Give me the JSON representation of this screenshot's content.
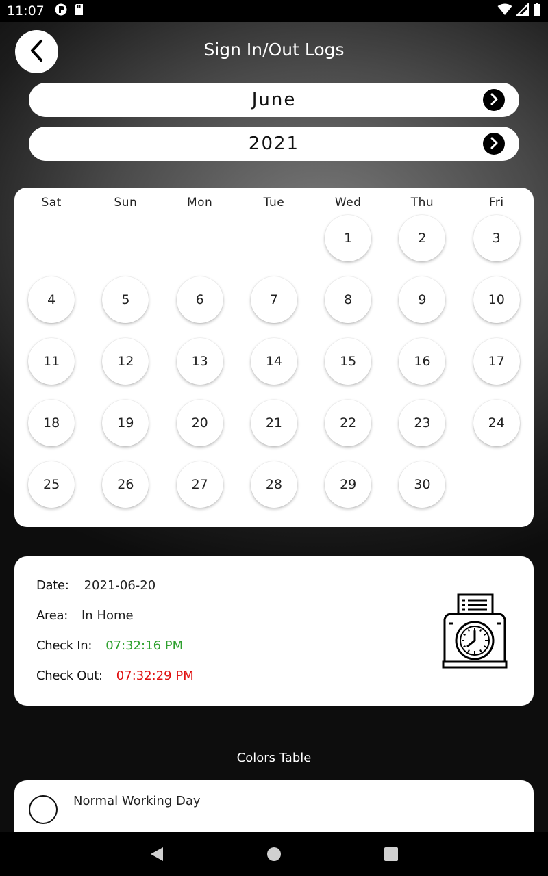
{
  "status_bar": {
    "time": "11:07",
    "left_icons": [
      "notification-app-icon",
      "sd-card-icon"
    ],
    "right_icons": [
      "wifi-icon",
      "signal-icon",
      "battery-icon"
    ]
  },
  "header": {
    "title": "Sign In/Out Logs",
    "back_icon": "chevron-left-icon"
  },
  "month_selector": {
    "value": "June",
    "next_icon": "chevron-right-icon"
  },
  "year_selector": {
    "value": "2021",
    "next_icon": "chevron-right-icon"
  },
  "calendar": {
    "weekdays": [
      "Sat",
      "Sun",
      "Mon",
      "Tue",
      "Wed",
      "Thu",
      "Fri"
    ],
    "weeks": [
      [
        "",
        "",
        "",
        "",
        "1",
        "2",
        "3"
      ],
      [
        "4",
        "5",
        "6",
        "7",
        "8",
        "9",
        "10"
      ],
      [
        "11",
        "12",
        "13",
        "14",
        "15",
        "16",
        "17"
      ],
      [
        "18",
        "19",
        "20",
        "21",
        "22",
        "23",
        "24"
      ],
      [
        "25",
        "26",
        "27",
        "28",
        "29",
        "30",
        ""
      ]
    ]
  },
  "details": {
    "date_label": "Date:",
    "date_value": "2021-06-20",
    "area_label": "Area:",
    "area_value": "In Home",
    "check_in_label": "Check In:",
    "check_in_value": "07:32:16 PM",
    "check_out_label": "Check Out:",
    "check_out_value": "07:32:29 PM",
    "icon": "time-clock-icon"
  },
  "colors": {
    "check_in": "#2ea02e",
    "check_out": "#e01010"
  },
  "colors_table": {
    "title": "Colors Table",
    "items": [
      {
        "label": "Normal Working Day",
        "icon": "empty-circle-icon"
      }
    ]
  },
  "nav_bar": {
    "icons": [
      "back-triangle-icon",
      "home-circle-icon",
      "recents-square-icon"
    ]
  }
}
